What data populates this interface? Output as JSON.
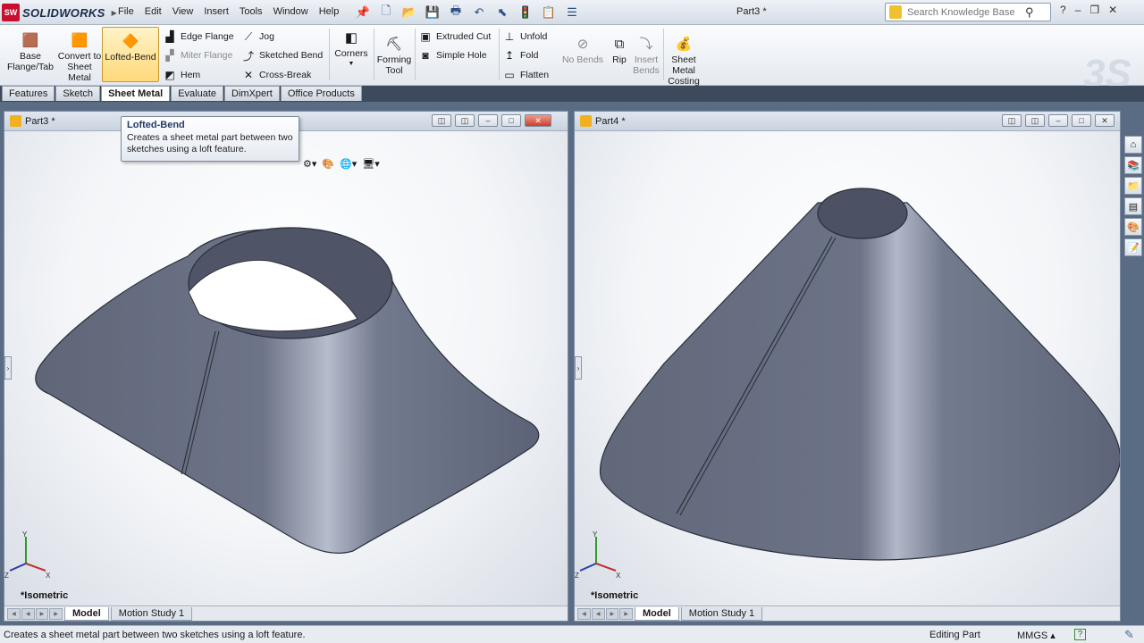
{
  "app": {
    "brand": "SOLIDWORKS",
    "doc_title": "Part3 *"
  },
  "menu": [
    "File",
    "Edit",
    "View",
    "Insert",
    "Tools",
    "Window",
    "Help"
  ],
  "search": {
    "placeholder": "Search Knowledge Base"
  },
  "ribbon": {
    "base_flange": "Base Flange/Tab",
    "convert": "Convert to Sheet Metal",
    "lofted_bend": "Lofted-Bend",
    "edge_flange": "Edge Flange",
    "miter_flange": "Miter Flange",
    "hem": "Hem",
    "jog": "Jog",
    "sketched_bend": "Sketched Bend",
    "cross_break": "Cross-Break",
    "corners": "Corners",
    "forming_tool": "Forming Tool",
    "extruded_cut": "Extruded Cut",
    "simple_hole": "Simple Hole",
    "unfold": "Unfold",
    "fold": "Fold",
    "flatten": "Flatten",
    "no_bends": "No Bends",
    "rip": "Rip",
    "insert_bends": "Insert Bends",
    "sheet_metal_costing": "Sheet Metal Costing"
  },
  "tabs": [
    "Features",
    "Sketch",
    "Sheet Metal",
    "Evaluate",
    "DimXpert",
    "Office Products"
  ],
  "tabs_active": "Sheet Metal",
  "tooltip": {
    "title": "Lofted-Bend",
    "desc": "Creates a sheet metal part between two sketches using a loft feature."
  },
  "viewports": [
    {
      "title": "Part3 *",
      "view": "*Isometric",
      "tabs": [
        "Model",
        "Motion Study 1"
      ]
    },
    {
      "title": "Part4 *",
      "view": "*Isometric",
      "tabs": [
        "Model",
        "Motion Study 1"
      ]
    }
  ],
  "status": {
    "message": "Creates a sheet metal part between two sketches using a loft feature.",
    "mode": "Editing Part",
    "units": "MMGS"
  },
  "colors": {
    "part": "#6b7285",
    "tab_bar": "#3d4a5c",
    "workspace": "#5a6b84",
    "highlight": "#ffd97a"
  }
}
